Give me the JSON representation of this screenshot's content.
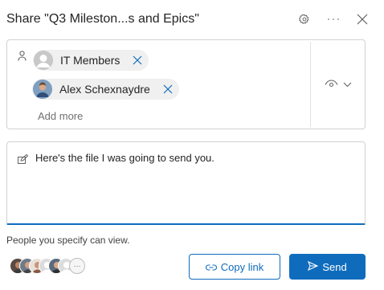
{
  "dialog": {
    "title": "Share \"Q3 Mileston...s and Epics\"",
    "settings_icon": "gear-icon",
    "more_icon": "more-icon",
    "close_icon": "close-icon"
  },
  "recipients": {
    "person_icon": "person-icon",
    "chips": [
      {
        "label": "IT Members",
        "avatar": "group-avatar"
      },
      {
        "label": "Alex Schexnaydre",
        "avatar": "user-photo"
      }
    ],
    "add_more_placeholder": "Add more",
    "permission_icon": "eye-icon"
  },
  "message": {
    "icon": "edit-icon",
    "text": "Here's the file I was going to send you."
  },
  "permission_note": "People you specify can view.",
  "shared_with": {
    "more_label": "···"
  },
  "actions": {
    "copy_link_label": "Copy link",
    "send_label": "Send"
  },
  "colors": {
    "accent": "#0f6cbd",
    "border": "#d1d1d1",
    "chip_bg": "#f0f0f0"
  }
}
